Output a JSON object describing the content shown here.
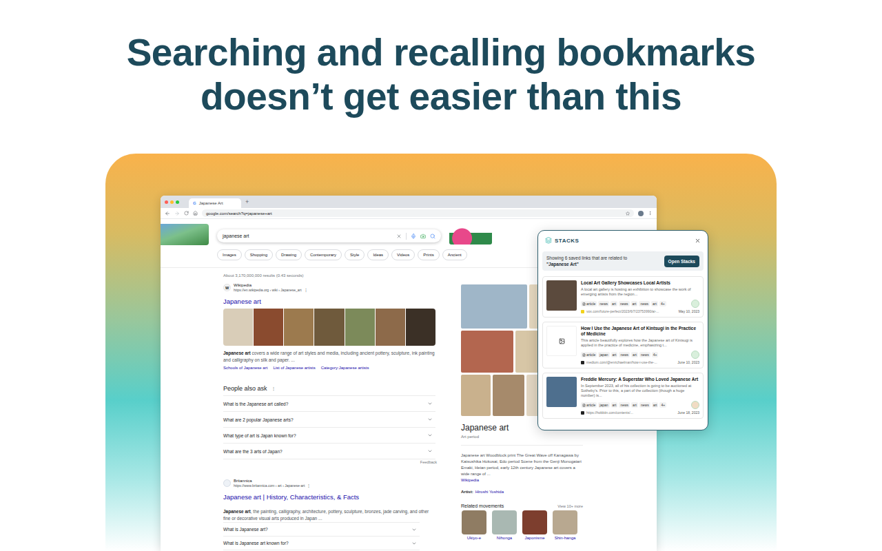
{
  "headline": {
    "lines": [
      "Searching and recalling bookmarks",
      "doesn’t get easier than this"
    ]
  },
  "browser": {
    "tab": {
      "favicon": "G",
      "title": "Japanese Art"
    },
    "new_tab": "+",
    "address": "google.com/search?q=japanese+art"
  },
  "search": {
    "query": "japanese art"
  },
  "chips": [
    "Images",
    "Shopping",
    "Drawing",
    "Contemporary",
    "Style",
    "Ideas",
    "Videos",
    "Prints",
    "Ancient"
  ],
  "result_stats": "About 3,170,000,000 results (0.43 seconds)",
  "wikipedia": {
    "site_icon": "W",
    "site": "Wikipedia",
    "url": "https://en.wikipedia.org › wiki › Japanese_art",
    "menu": "⋮",
    "title": "Japanese art",
    "snippet_bold": "Japanese art",
    "snippet": " covers a wide range of art styles and media, including ancient pottery, sculpture, ink painting and calligraphy on silk and paper. ...",
    "links": [
      "Schools of Japanese art",
      "List of Japanese artists",
      "Category:Japanese artists"
    ]
  },
  "people_also_ask": {
    "title": "People also ask",
    "menu": "⋮",
    "questions": [
      "What is the Japanese art called?",
      "What are 2 popular Japanese arts?",
      "What type of art is Japan known for?",
      "What are the 3 arts of Japan?"
    ],
    "feedback": "Feedback"
  },
  "britannica": {
    "site": "Britannica",
    "url": "https://www.britannica.com › art › Japanese-art",
    "menu": "⋮",
    "title": "Japanese art | History, Characteristics, & Facts",
    "snippet_bold": "Japanese art",
    "snippet": ", the painting, calligraphy, architecture, pottery, sculpture, bronzes, jade carving, and other fine or decorative visual arts produced in Japan ...",
    "questions": [
      "What is Japanese art?",
      "What is Japanese art known for?"
    ]
  },
  "knowledge_panel": {
    "title": "Japanese art",
    "subtitle": "Art period",
    "description": "Japanese art Woodblock print The Great Wave off Kanagawa by Katsushika Hokusai, Edo period Scene from the Genji Monogatari Emaki, Heian period, early 12th century Japanese art covers a wide range of ...",
    "source": "Wikipedia",
    "artist_label": "Artist:",
    "artist": "Hiroshi Yoshida",
    "related_title": "Related movements",
    "related_more": "View 10+ more",
    "movements": [
      "Ukiyo-e",
      "Nihonga",
      "Japonisme",
      "Shin-hanga"
    ]
  },
  "stacks": {
    "brand": "STACKS",
    "summary": "Showing 6 saved links that are related to",
    "query": "\"Japanese Art\"",
    "open_button": "Open Stacks",
    "cards": [
      {
        "kind": "photo",
        "title": "Local Art Gallery Showcases Local Artists",
        "description": "A local art gallery is hosting an exhibition to showcase the work of emerging artists from the region...",
        "tags": [
          "article",
          "news",
          "art",
          "news",
          "art",
          "news",
          "art"
        ],
        "more": "4+",
        "url": "vox.com/future-perfect/2023/6/7/23753990/ai-...",
        "date": "May 10, 2023"
      },
      {
        "kind": "placeholder",
        "title": "How I Use the Japanese Art of Kintsugi in the Practice of Medicine",
        "description": "This article beautifully explores how the Japanese art of Kintsugi is applied in the practice of medicine, emphasizing t...",
        "tags": [
          "article",
          "japan",
          "art",
          "news",
          "art",
          "news"
        ],
        "more": "4+",
        "url": "medium.com/@enrichaelman/how-i-use-the-...",
        "date": "June 10, 2023"
      },
      {
        "kind": "photo",
        "title": "Freddie Mercury: A Superstar Who Loved Japanese Art",
        "description": "In September 2023, all of his collection is going to be auctioned at Sotheby's. Prior to this, a part of the collection (though a huge number) is...",
        "tags": [
          "article",
          "japan",
          "art",
          "news",
          "art",
          "news",
          "art"
        ],
        "more": "4+",
        "url": "https://hobbiin.com/contents/...",
        "date": "June 18, 2023"
      }
    ]
  }
}
